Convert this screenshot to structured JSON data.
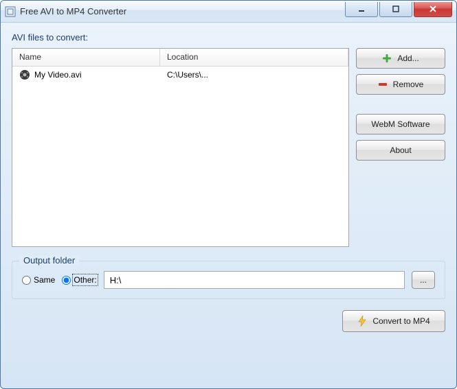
{
  "window": {
    "title": "Free AVI to MP4 Converter"
  },
  "section": {
    "files_label": "AVI files to convert:"
  },
  "filelist": {
    "cols": {
      "name": "Name",
      "location": "Location"
    },
    "rows": [
      {
        "name": "My Video.avi",
        "location": "C:\\Users\\..."
      }
    ]
  },
  "buttons": {
    "add": "Add...",
    "remove": "Remove",
    "webm": "WebM Software",
    "about": "About",
    "convert": "Convert to MP4",
    "browse": "..."
  },
  "output": {
    "group_title": "Output folder",
    "same_label": "Same",
    "other_label": "Other:",
    "path": "H:\\"
  }
}
